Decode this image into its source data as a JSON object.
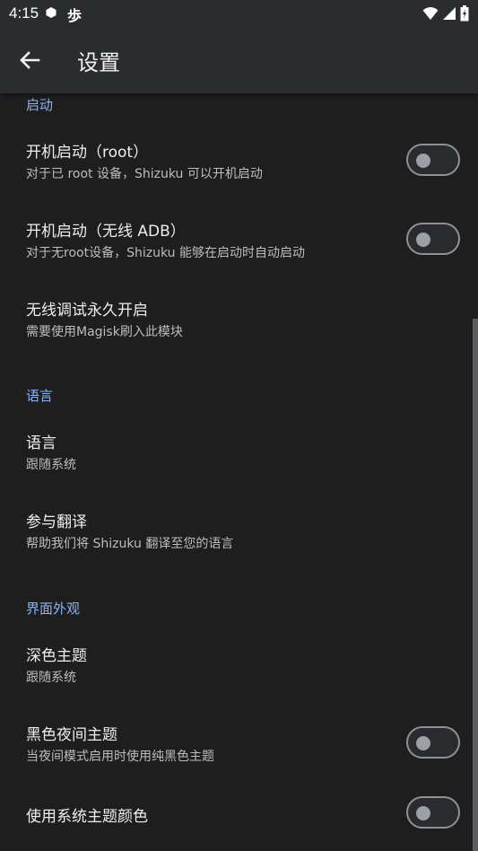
{
  "status_bar": {
    "time": "4:15",
    "icons": [
      "settings-dot-icon",
      "chinese-char-notification-icon",
      "wifi-icon",
      "signal-icon",
      "battery-icon"
    ],
    "notification_char": "歩"
  },
  "app_bar": {
    "title": "设置",
    "back_icon": "arrow-left-icon"
  },
  "sections": [
    {
      "header": "启动",
      "items": [
        {
          "title": "开机启动（root）",
          "summary": "对于已 root 设备，Shizuku 可以开机启动",
          "switch": false
        },
        {
          "title": "开机启动（无线 ADB）",
          "summary": "对于无root设备，Shizuku 能够在启动时自动启动",
          "switch": false
        },
        {
          "title": "无线调试永久开启",
          "summary": "需要使用Magisk刷入此模块"
        }
      ]
    },
    {
      "header": "语言",
      "items": [
        {
          "title": "语言",
          "summary": "跟随系统"
        },
        {
          "title": "参与翻译",
          "summary": "帮助我们将 Shizuku 翻译至您的语言"
        }
      ]
    },
    {
      "header": "界面外观",
      "items": [
        {
          "title": "深色主题",
          "summary": "跟随系统"
        },
        {
          "title": "黑色夜间主题",
          "summary": "当夜间模式启用时使用纯黑色主题",
          "switch": false
        },
        {
          "title": "使用系统主题颜色",
          "switch": false
        }
      ]
    }
  ],
  "colors": {
    "background": "#1e1e1f",
    "app_bar": "#2a2c30",
    "section_header": "#8ab4f8",
    "summary_text": "#bdbdbd"
  }
}
